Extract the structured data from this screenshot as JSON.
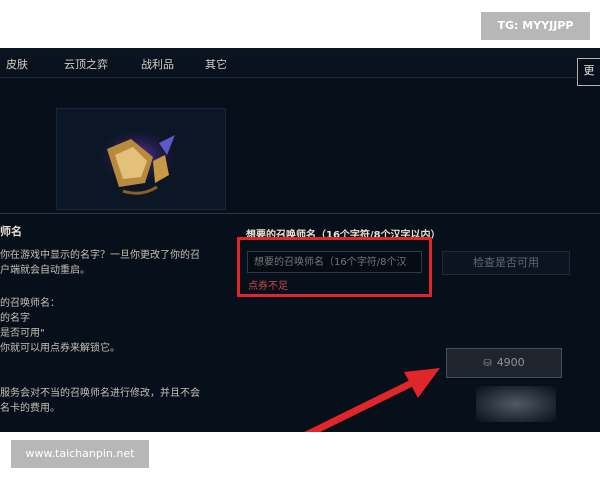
{
  "nav": {
    "items": [
      {
        "label": "皮肤"
      },
      {
        "label": "云顶之弈"
      },
      {
        "label": "战利品"
      },
      {
        "label": "其它"
      }
    ],
    "corner_button": "更"
  },
  "left_panel": {
    "title": "师名",
    "description": "你在游戏中显示的名字？一旦你更改了你的召\n户端就会自动重启。",
    "list": "的召唤师名：\n的名字\n是否可用\"\n你就可以用点券来解锁它。",
    "warning": "服务会对不当的召唤师名进行修改，并且不会\n名卡的费用。"
  },
  "name_change": {
    "label": "想要的召唤师名（16个字符/8个汉字以内）",
    "input_placeholder": "想要的召唤师名（16个字符/8个汉",
    "error": "点券不足",
    "check_button": "检查是否可用",
    "price": "4900",
    "price_icon": "rp-coin-icon"
  },
  "watermarks": {
    "top": "TG: MYYJJPP",
    "bottom": "www.taichanpin.net"
  },
  "colors": {
    "background": "#070f1a",
    "highlight": "#e0262a",
    "error": "#c94a44"
  }
}
